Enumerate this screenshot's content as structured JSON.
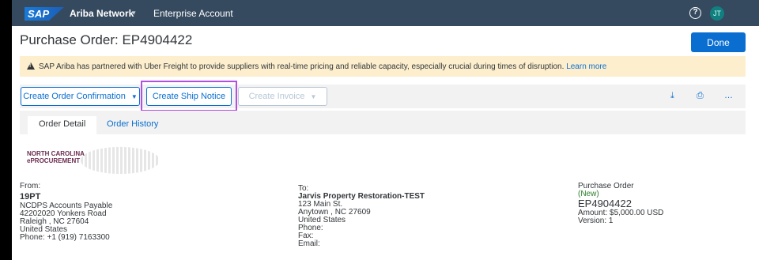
{
  "topbar": {
    "logo_text": "SAP",
    "network_label": "Ariba Network",
    "network_chevron": "▾",
    "account_label": "Enterprise Account",
    "help_icon": "?",
    "avatar_initials": "JT"
  },
  "page": {
    "title": "Purchase Order: EP4904422",
    "done_label": "Done"
  },
  "banner": {
    "message": "SAP Ariba has partnered with Uber Freight to provide suppliers with real-time pricing and reliable capacity, especially crucial during times of disruption.",
    "link_label": "Learn more"
  },
  "toolbar": {
    "create_confirmation_label": "Create Order Confirmation",
    "create_ship_notice_label": "Create Ship Notice",
    "create_invoice_label": "Create Invoice",
    "caret": "▼",
    "download_icon": "⤓",
    "print_icon": "⎙",
    "more_icon": "…"
  },
  "tabs": {
    "order_detail": "Order Detail",
    "order_history": "Order History"
  },
  "logo": {
    "line1": "NORTH CAROLINA",
    "line2": "ePROCUREMENT"
  },
  "from": {
    "heading": "From:",
    "code": "19PT",
    "name": "NCDPS Accounts Payable",
    "street": "42202020 Yonkers Road",
    "city": "Raleigh , NC 27604",
    "country": "United States",
    "phone": "Phone:  +1 (919) 7163300"
  },
  "to": {
    "heading": "To:",
    "name": "Jarvis Property Restoration-TEST",
    "street": "123 Main St.",
    "city": "Anytown , NC 27609",
    "country": "United States",
    "phone": "Phone:",
    "fax": "Fax:",
    "email": "Email:"
  },
  "purchase_order": {
    "heading": "Purchase Order",
    "status": "(New)",
    "number": "EP4904422",
    "amount": "Amount: $5,000.00 USD",
    "version": "Version: 1"
  }
}
